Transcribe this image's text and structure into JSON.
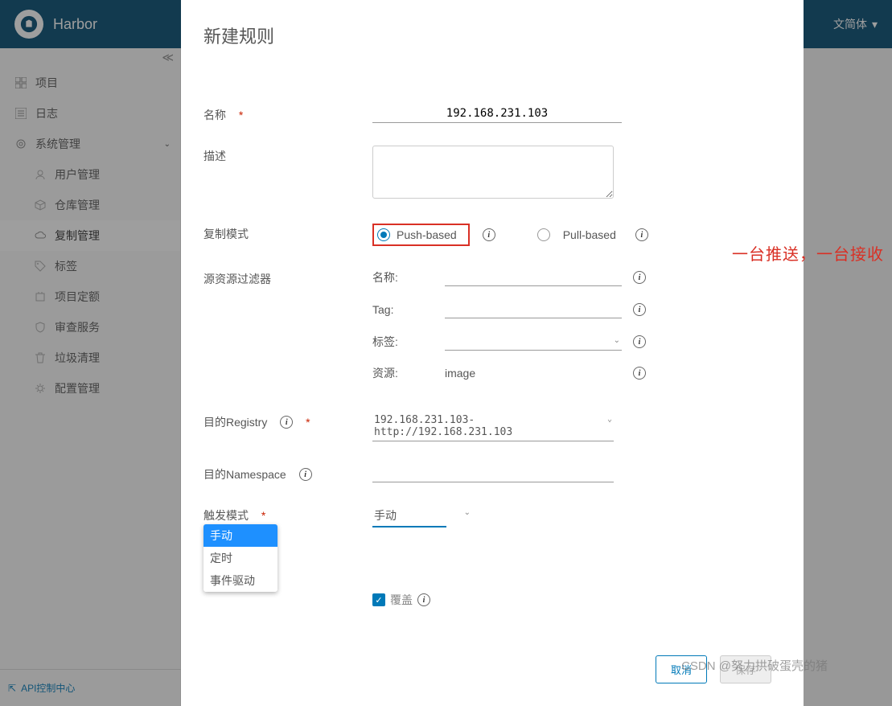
{
  "header": {
    "brand": "Harbor",
    "lang": "文简体"
  },
  "sidebar": {
    "items": [
      {
        "label": "项目",
        "icon": "grid"
      },
      {
        "label": "日志",
        "icon": "list"
      },
      {
        "label": "系统管理",
        "icon": "gear",
        "caret": true
      }
    ],
    "subitems": [
      {
        "label": "用户管理",
        "icon": "user"
      },
      {
        "label": "仓库管理",
        "icon": "cube"
      },
      {
        "label": "复制管理",
        "icon": "cloud",
        "active": true
      },
      {
        "label": "标签",
        "icon": "tag"
      },
      {
        "label": "项目定额",
        "icon": "trash"
      },
      {
        "label": "审查服务",
        "icon": "shield"
      },
      {
        "label": "垃圾清理",
        "icon": "trash2"
      },
      {
        "label": "配置管理",
        "icon": "cog"
      }
    ],
    "footer": "API控制中心"
  },
  "modal": {
    "title": "新建规则",
    "labels": {
      "name": "名称",
      "desc": "描述",
      "mode": "复制模式",
      "filter": "源资源过滤器",
      "registry": "目的Registry",
      "namespace": "目的Namespace",
      "trigger": "触发模式",
      "override": "覆盖"
    },
    "values": {
      "name": "192.168.231.103",
      "mode_push": "Push-based",
      "mode_pull": "Pull-based",
      "filter_name": "名称:",
      "filter_tag": "Tag:",
      "filter_label": "标签:",
      "filter_resource": "资源:",
      "resource_val": "image",
      "registry_sel": "192.168.231.103-http://192.168.231.103",
      "trigger_sel": "手动"
    },
    "dropdown": [
      "手动",
      "定时",
      "事件驱动"
    ],
    "buttons": {
      "cancel": "取消",
      "save": "保存"
    }
  },
  "annotation": "一台推送，一台接收",
  "watermark": "CSDN @努力拱破蛋壳的猪"
}
